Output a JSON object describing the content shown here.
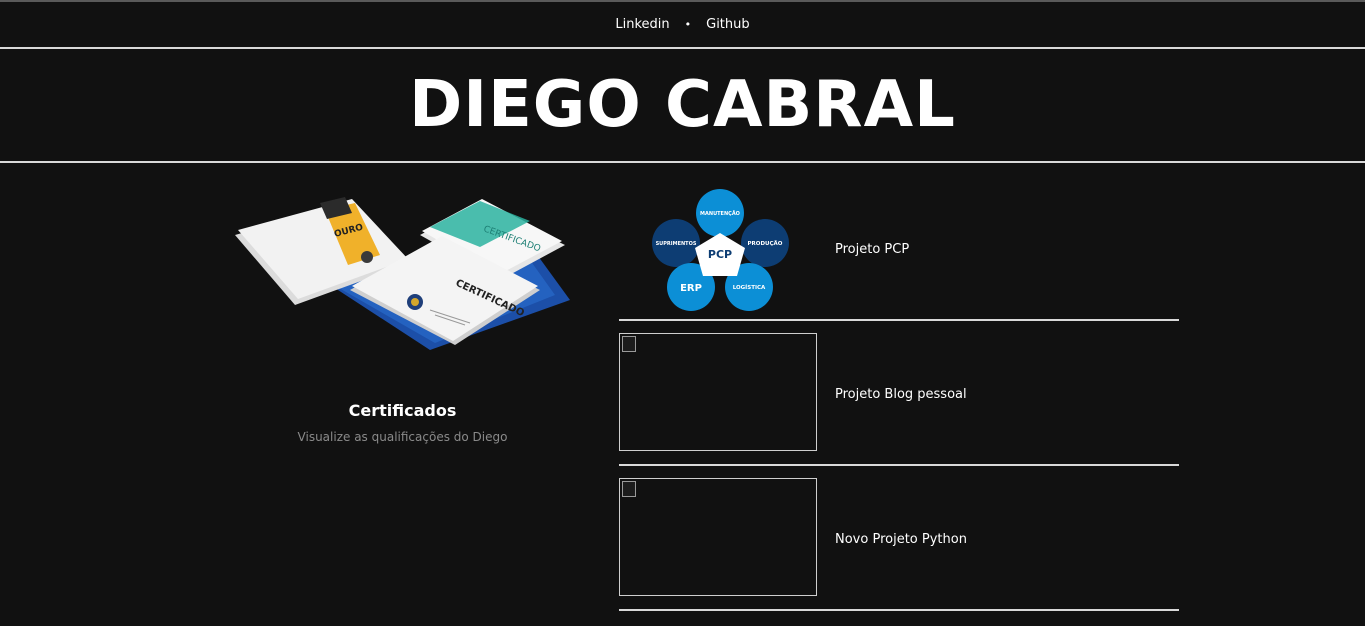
{
  "nav": {
    "links": [
      "Linkedin",
      "Github"
    ],
    "separator": "•"
  },
  "header": {
    "title": "DIEGO CABRAL"
  },
  "certificates": {
    "title": "Certificados",
    "subtitle": "Visualize as qualificações do Diego",
    "image_text": [
      "CERTIFICADO",
      "CERTIFICADO",
      "OURO"
    ]
  },
  "projects": [
    {
      "label": "Projeto PCP",
      "image": "pcp-diagram",
      "diagram_labels": [
        "MANUTENÇÃO",
        "SUPRIMENTOS",
        "PCP",
        "PRODUÇÃO",
        "ERP",
        "LOGÍSTICA"
      ]
    },
    {
      "label": "Projeto Blog pessoal",
      "image": "broken-image"
    },
    {
      "label": "Novo Projeto Python",
      "image": "broken-image"
    }
  ],
  "colors": {
    "background": "#111111",
    "text": "#ffffff",
    "muted": "#8a8a8a",
    "rule": "#d9d9d9",
    "pcp_blue": "#0c8fd6",
    "pcp_navy": "#0d3d73"
  }
}
